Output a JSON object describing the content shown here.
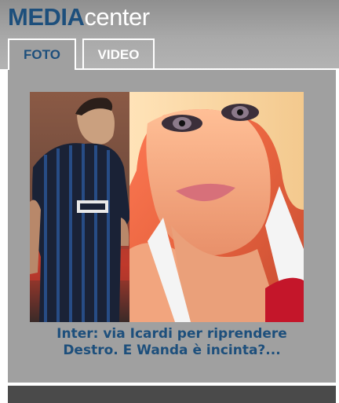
{
  "logo": {
    "part1": "MEDIA",
    "part2": "center"
  },
  "tabs": [
    {
      "label": "FOTO",
      "active": true
    },
    {
      "label": "VIDEO",
      "active": false
    }
  ],
  "gallery": {
    "caption_line1": "Inter: via Icardi per riprendere",
    "caption_line2": "Destro. E Wanda è incinta?..."
  },
  "colors": {
    "brand_blue": "#1d4f7c",
    "panel_gray": "#a0a0a0",
    "footer_dark": "#4a4a4a"
  }
}
